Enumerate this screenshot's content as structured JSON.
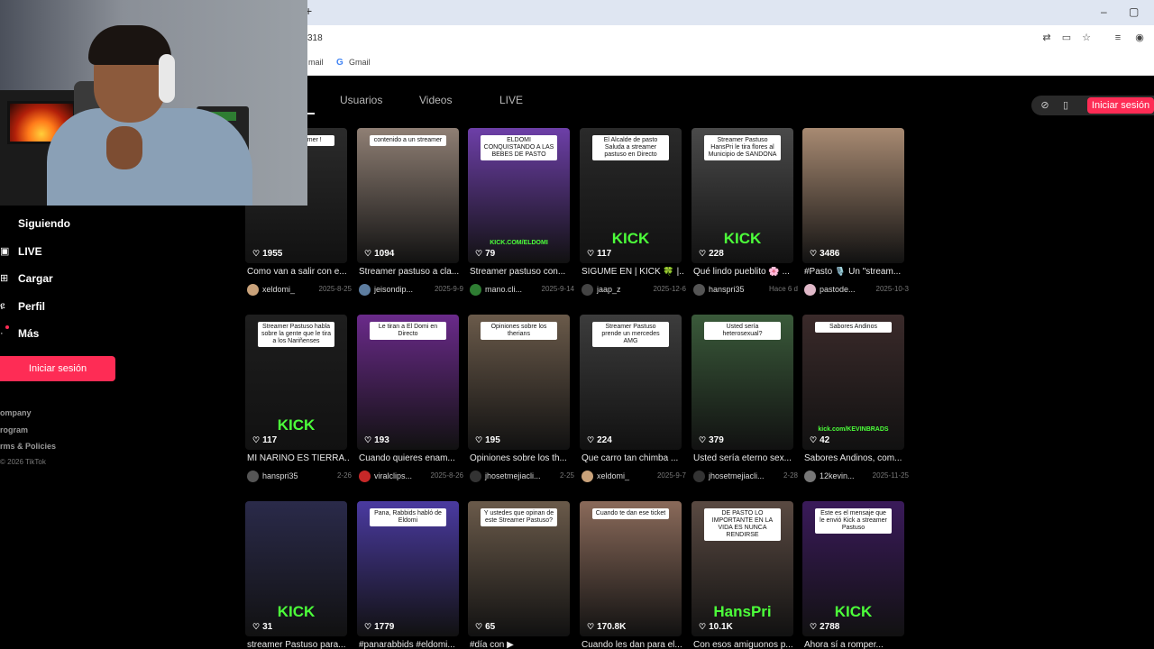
{
  "browser": {
    "newtab_glyph": "+",
    "url": "318",
    "bookmarks": [
      {
        "label": "mail"
      },
      {
        "label": "Gmail"
      }
    ],
    "window": {
      "minimize": "–",
      "restore": "▢"
    }
  },
  "tabs": [
    {
      "label": "Usuarios"
    },
    {
      "label": "Videos"
    },
    {
      "label": "LIVE"
    }
  ],
  "top_right": {
    "login": "Iniciar sesión"
  },
  "sidebar": {
    "items": [
      {
        "label": "Siguiendo"
      },
      {
        "label": "LIVE"
      },
      {
        "label": "Cargar"
      },
      {
        "label": "Perfil"
      },
      {
        "label": "Más"
      }
    ],
    "login": "Iniciar sesión",
    "footer": [
      "ompany",
      "rogram",
      "rms & Policies"
    ],
    "copyright": "2026 TikTok"
  },
  "videos": [
    {
      "likes": "1955",
      "desc": "Como van a salir con e...",
      "author": "xeldomi_",
      "date": "2025-8-25",
      "overlay": "s hacer streamer !",
      "brand": "",
      "color": "#2b2b2b",
      "avatar": "#c9a27a"
    },
    {
      "likes": "1094",
      "desc": "Streamer pastuso a cla...",
      "author": "jeisondip...",
      "date": "2025-9-9",
      "overlay": "contenido a un streamer",
      "brand": "",
      "color": "#8f7f74",
      "avatar": "#5d7da0"
    },
    {
      "likes": "79",
      "desc": "Streamer pastuso con...",
      "author": "mano.cli...",
      "date": "2025-9-14",
      "overlay": "ELDOMI CONQUISTANDO A LAS BEBES DE PASTO",
      "brand": "KICK.COM/ELDOMI",
      "color": "#6d3fa8",
      "avatar": "#2e7d32"
    },
    {
      "likes": "117",
      "desc": "SIGUME EN | KICK 🍀 |...",
      "author": "jaap_z",
      "date": "2025-12-6",
      "overlay": "El Alcalde de pasto Saluda a streamer pastuso en Directo",
      "brand": "KICK",
      "color": "#2a2a2a",
      "avatar": "#444444"
    },
    {
      "likes": "228",
      "desc": "Qué lindo pueblito 🌸 ...",
      "author": "hanspri35",
      "date": "Hace 6 d",
      "overlay": "Streamer Pastuso HansPri le tira flores al Municipio de SANDONA",
      "brand": "KICK",
      "color": "#4a4a4a",
      "avatar": "#555555"
    },
    {
      "likes": "3486",
      "desc": "#Pasto 🎙️ Un \"stream...",
      "author": "pastode...",
      "date": "2025-10-3",
      "overlay": "",
      "brand": "",
      "color": "#a88a72",
      "avatar": "#e0b8c8"
    },
    {
      "likes": "117",
      "desc": "MI NARIÑO ES TIERRA...",
      "author": "hanspri35",
      "date": "2-26",
      "overlay": "Streamer Pastuso habla sobre la gente que le tira a los Nariñenses",
      "brand": "KICK",
      "color": "#1e1e1e",
      "avatar": "#555555"
    },
    {
      "likes": "193",
      "desc": "Cuando quieres enam...",
      "author": "viralclips...",
      "date": "2025-8-26",
      "overlay": "Le tiran a El Domi en Directo",
      "brand": "",
      "color": "#6a2a8a",
      "avatar": "#c62828"
    },
    {
      "likes": "195",
      "desc": "Opiniones sobre los th...",
      "author": "jhosetmejiacli...",
      "date": "2-25",
      "overlay": "Opiniones sobre los therians",
      "brand": "",
      "color": "#6a5a4a",
      "avatar": "#333333"
    },
    {
      "likes": "224",
      "desc": "Que carro tan chimba ...",
      "author": "xeldomi_",
      "date": "2025-9-7",
      "overlay": "Streamer Pastuso prende un mercedes AMG",
      "brand": "",
      "color": "#3c3c3c",
      "avatar": "#c9a27a"
    },
    {
      "likes": "379",
      "desc": "Usted sería eterno sex...",
      "author": "jhosetmejiacli...",
      "date": "2-28",
      "overlay": "Usted sería heterosexual?",
      "brand": "",
      "color": "#3a5a3a",
      "avatar": "#333333"
    },
    {
      "likes": "42",
      "desc": "Sabores Andinos, com...",
      "author": "12kevin...",
      "date": "2025-11-25",
      "overlay": "Sabores Andinos",
      "brand": "kick.com/KEVINBRADS",
      "color": "#3a2a2a",
      "avatar": "#777777"
    },
    {
      "likes": "31",
      "desc": "streamer Pastuso para...",
      "author": "",
      "date": "",
      "overlay": "",
      "brand": "KICK",
      "color": "#2a2a4a",
      "avatar": "#555555"
    },
    {
      "likes": "1779",
      "desc": "#panarabbids #eldomi...",
      "author": "",
      "date": "",
      "overlay": "Pana, Rabbids habló de Eldomi",
      "brand": "",
      "color": "#4a3aa0",
      "avatar": "#555555"
    },
    {
      "likes": "65",
      "desc": "#día con ▶",
      "author": "",
      "date": "",
      "overlay": "Y ustedes que opinan de este Streamer Pastuso?",
      "brand": "",
      "color": "#6a5a4a",
      "avatar": "#555555"
    },
    {
      "likes": "170.8K",
      "desc": "Cuando les dan para el...",
      "author": "",
      "date": "",
      "overlay": "Cuando te dan ese ticket",
      "brand": "",
      "color": "#8a6a5a",
      "avatar": "#555555"
    },
    {
      "likes": "10.1K",
      "desc": "Con esos amiguonos p...",
      "author": "",
      "date": "",
      "overlay": "DE PASTO LO IMPORTANTE EN LA VIDA ES NUNCA RENDIRSE",
      "brand": "HansPri",
      "color": "#5a4a42",
      "avatar": "#555555"
    },
    {
      "likes": "2788",
      "desc": "Ahora sí a romper...",
      "author": "",
      "date": "",
      "overlay": "Este es el mensaje que le envió Kick a streamer Pastuso",
      "brand": "KICK",
      "color": "#3a1a5a",
      "avatar": "#555555"
    }
  ]
}
